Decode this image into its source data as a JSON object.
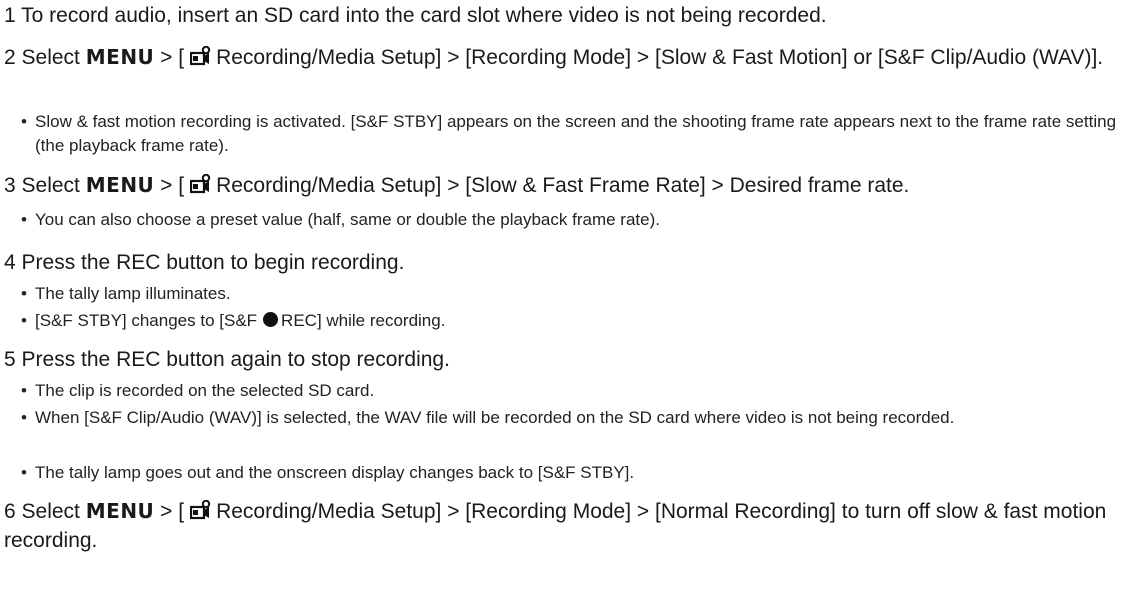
{
  "menu_word": "MENU",
  "steps": [
    {
      "num": "1",
      "text": "To record audio, insert an SD card into the card slot where video is not being recorded."
    },
    {
      "num": "2",
      "pre": "Select",
      "post": "Recording/Media Setup] > [Recording Mode] > [Slow & Fast Motion] or [S&F Clip/Audio (WAV)].",
      "bullets": [
        "Slow & fast motion recording is activated. [S&F STBY] appears on the screen and the shooting frame rate appears next to the frame rate setting (the playback frame rate)."
      ]
    },
    {
      "num": "3",
      "pre": "Select",
      "post": "Recording/Media Setup] > [Slow & Fast Frame Rate] > Desired frame rate.",
      "bullets": [
        "You can also choose a preset value (half, same or double the playback frame rate)."
      ]
    },
    {
      "num": "4",
      "text": "Press the REC button to begin recording.",
      "bullets": [
        "The tally lamp illuminates."
      ],
      "bullet_rec_pre": "[S&F STBY] changes to [S&F",
      "bullet_rec_post": "REC] while recording."
    },
    {
      "num": "5",
      "text": "Press the REC button again to stop recording.",
      "bullets": [
        "The clip is recorded on the selected SD card.",
        "When [S&F Clip/Audio (WAV)] is selected, the WAV file will be recorded on the SD card where video is not being recorded.",
        "The tally lamp goes out and the onscreen display changes back to [S&F STBY]."
      ]
    },
    {
      "num": "6",
      "pre": "Select",
      "post": "Recording/Media Setup] > [Recording Mode] > [Normal Recording] to turn off slow & fast motion recording."
    }
  ],
  "icons": {
    "bullet": "•",
    "camera_setup": "camera-setup-icon",
    "rec_dot": "record-dot-icon"
  }
}
